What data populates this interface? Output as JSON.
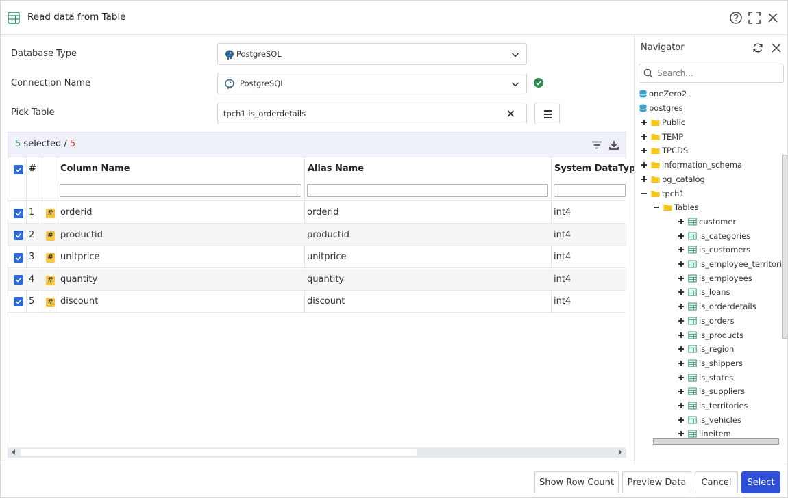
{
  "window": {
    "title": "Read data from Table"
  },
  "form": {
    "database_type_label": "Database Type",
    "database_type_value": "PostgreSQL",
    "connection_name_label": "Connection Name",
    "connection_name_value": "PostgreSQL",
    "pick_table_label": "Pick Table",
    "pick_table_value": "tpch1.is_orderdetails",
    "pick_table_clear": "×"
  },
  "grid": {
    "selected_count": "5",
    "selected_text": "selected /",
    "total_count": "5",
    "columns": [
      "#",
      "Column Name",
      "Alias Name",
      "System DataTyp"
    ],
    "rows": [
      {
        "num": "1",
        "type_badge": "#",
        "column": "orderid",
        "alias": "orderid",
        "dtype": "int4"
      },
      {
        "num": "2",
        "type_badge": "#",
        "column": "productid",
        "alias": "productid",
        "dtype": "int4"
      },
      {
        "num": "3",
        "type_badge": "#",
        "column": "unitprice",
        "alias": "unitprice",
        "dtype": "int4"
      },
      {
        "num": "4",
        "type_badge": "#",
        "column": "quantity",
        "alias": "quantity",
        "dtype": "int4"
      },
      {
        "num": "5",
        "type_badge": "#",
        "column": "discount",
        "alias": "discount",
        "dtype": "int4"
      }
    ]
  },
  "navigator": {
    "title": "Navigator",
    "search_placeholder": "Search...",
    "roots": [
      "oneZero2",
      "postgres"
    ],
    "schemas": [
      "Public",
      "TEMP",
      "TPCDS",
      "information_schema",
      "pg_catalog",
      "tpch1"
    ],
    "tables_folder": "Tables",
    "tables": [
      "customer",
      "is_categories",
      "is_customers",
      "is_employee_territories",
      "is_employees",
      "is_loans",
      "is_orderdetails",
      "is_orders",
      "is_products",
      "is_region",
      "is_shippers",
      "is_states",
      "is_suppliers",
      "is_territories",
      "is_vehicles",
      "lineitem"
    ]
  },
  "footer": {
    "show_row_count": "Show Row Count",
    "preview_data": "Preview Data",
    "cancel": "Cancel",
    "select": "Select"
  },
  "colors": {
    "primary": "#2f4fd8",
    "checkbox": "#2f67d6",
    "success": "#2e8b4e",
    "danger": "#d23b3b",
    "folder": "#f5c518",
    "badge": "#f4c542"
  },
  "icons": [
    "table-icon",
    "help-icon",
    "maximize-icon",
    "close-icon",
    "postgresql-icon",
    "chevron-down-icon",
    "check-circle-icon",
    "menu-icon",
    "filter-icon",
    "download-icon",
    "refresh-icon",
    "search-icon",
    "database-icon",
    "folder-icon",
    "plus-icon",
    "minus-icon"
  ]
}
